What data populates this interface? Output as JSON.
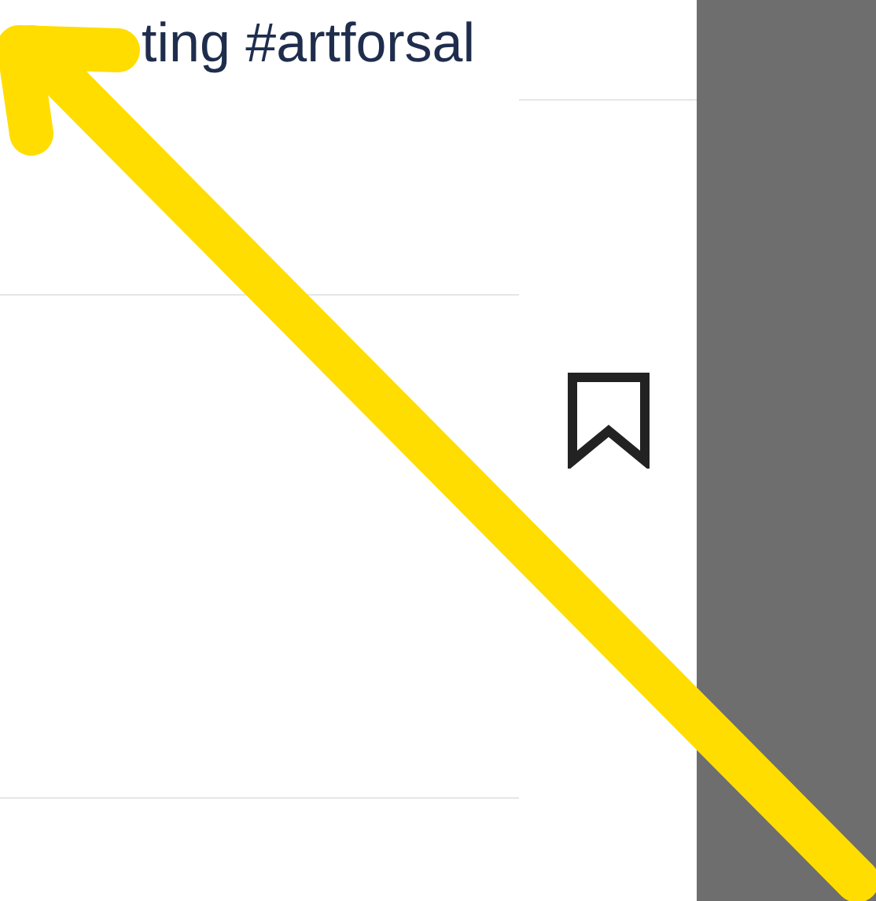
{
  "caption": {
    "text": "ting #artforsal"
  }
}
